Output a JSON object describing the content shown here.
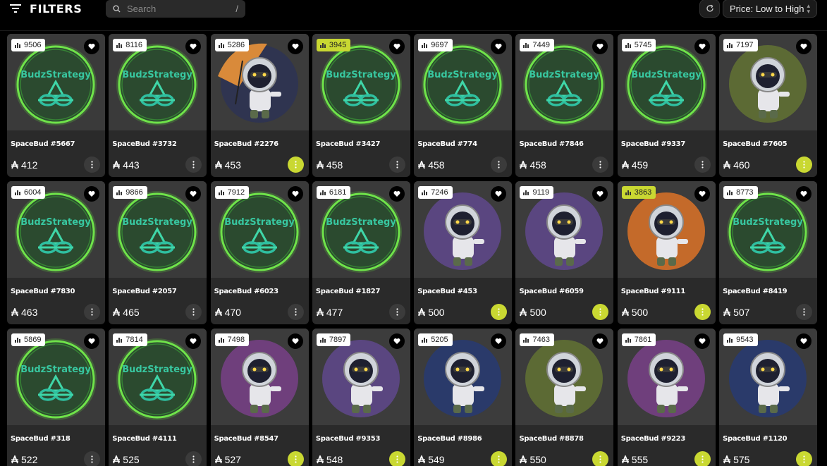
{
  "header": {
    "filters_label": "FILTERS",
    "search_placeholder": "Search",
    "search_shortcut": "/",
    "sort_label": "Price: Low to High"
  },
  "colors": {
    "accent": "#c9d832",
    "card_bg": "#2a2a2a",
    "page_bg": "#000000"
  },
  "icons": {
    "filter": "filter-lines-icon",
    "search": "search-icon",
    "refresh": "refresh-icon",
    "sort": "chevron-up-down-icon",
    "rank": "bar-chart-icon",
    "favorite": "heart-icon",
    "currency": "ada-icon",
    "more": "more-vertical-icon"
  },
  "cards": [
    {
      "name": "SpaceBud #5667",
      "price": "412",
      "rank": "9506",
      "rank_hi": false,
      "more_hi": false,
      "art": "budz"
    },
    {
      "name": "SpaceBud #3732",
      "price": "443",
      "rank": "8116",
      "rank_hi": false,
      "more_hi": false,
      "art": "budz"
    },
    {
      "name": "SpaceBud #2276",
      "price": "453",
      "rank": "5286",
      "rank_hi": false,
      "more_hi": true,
      "art": "umbrella"
    },
    {
      "name": "SpaceBud #3427",
      "price": "458",
      "rank": "3945",
      "rank_hi": true,
      "more_hi": false,
      "art": "budz"
    },
    {
      "name": "SpaceBud #774",
      "price": "458",
      "rank": "9697",
      "rank_hi": false,
      "more_hi": false,
      "art": "budz"
    },
    {
      "name": "SpaceBud #7846",
      "price": "458",
      "rank": "7449",
      "rank_hi": false,
      "more_hi": false,
      "art": "budz"
    },
    {
      "name": "SpaceBud #9337",
      "price": "459",
      "rank": "5745",
      "rank_hi": false,
      "more_hi": false,
      "art": "budz"
    },
    {
      "name": "SpaceBud #7605",
      "price": "460",
      "rank": "7197",
      "rank_hi": false,
      "more_hi": true,
      "art": "olive"
    },
    {
      "name": "SpaceBud #7830",
      "price": "463",
      "rank": "6004",
      "rank_hi": false,
      "more_hi": false,
      "art": "budz"
    },
    {
      "name": "SpaceBud #2057",
      "price": "465",
      "rank": "9866",
      "rank_hi": false,
      "more_hi": false,
      "art": "budz"
    },
    {
      "name": "SpaceBud #6023",
      "price": "470",
      "rank": "7912",
      "rank_hi": false,
      "more_hi": false,
      "art": "budz"
    },
    {
      "name": "SpaceBud #1827",
      "price": "477",
      "rank": "6181",
      "rank_hi": false,
      "more_hi": false,
      "art": "budz"
    },
    {
      "name": "SpaceBud #453",
      "price": "500",
      "rank": "7246",
      "rank_hi": false,
      "more_hi": true,
      "art": "purple"
    },
    {
      "name": "SpaceBud #6059",
      "price": "500",
      "rank": "9119",
      "rank_hi": false,
      "more_hi": true,
      "art": "purple"
    },
    {
      "name": "SpaceBud #9111",
      "price": "500",
      "rank": "3863",
      "rank_hi": true,
      "more_hi": true,
      "art": "orange"
    },
    {
      "name": "SpaceBud #8419",
      "price": "507",
      "rank": "8773",
      "rank_hi": false,
      "more_hi": false,
      "art": "budz"
    },
    {
      "name": "SpaceBud #318",
      "price": "522",
      "rank": "5869",
      "rank_hi": false,
      "more_hi": false,
      "art": "budz"
    },
    {
      "name": "SpaceBud #4111",
      "price": "525",
      "rank": "7814",
      "rank_hi": false,
      "more_hi": false,
      "art": "budz"
    },
    {
      "name": "SpaceBud #8547",
      "price": "527",
      "rank": "7498",
      "rank_hi": false,
      "more_hi": true,
      "art": "magenta"
    },
    {
      "name": "SpaceBud #9353",
      "price": "548",
      "rank": "7897",
      "rank_hi": false,
      "more_hi": true,
      "art": "purple"
    },
    {
      "name": "SpaceBud #8986",
      "price": "549",
      "rank": "5205",
      "rank_hi": false,
      "more_hi": true,
      "art": "navy"
    },
    {
      "name": "SpaceBud #8878",
      "price": "550",
      "rank": "7463",
      "rank_hi": false,
      "more_hi": true,
      "art": "olive"
    },
    {
      "name": "SpaceBud #9223",
      "price": "555",
      "rank": "7861",
      "rank_hi": false,
      "more_hi": true,
      "art": "magenta"
    },
    {
      "name": "SpaceBud #1120",
      "price": "575",
      "rank": "9543",
      "rank_hi": false,
      "more_hi": true,
      "art": "navy"
    }
  ],
  "art_text": "BudzStrategy",
  "art_colors": {
    "purple": "#5a4680",
    "olive": "#5c6a34",
    "orange": "#c46a2a",
    "magenta": "#6f3f7c",
    "navy": "#2a3a6a",
    "umbrella": "#2f3450"
  }
}
